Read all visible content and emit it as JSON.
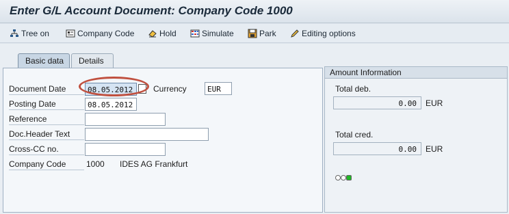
{
  "window": {
    "title": "Enter G/L Account Document: Company Code 1000"
  },
  "toolbar": {
    "tree_on": "Tree on",
    "company_code": "Company Code",
    "hold": "Hold",
    "simulate": "Simulate",
    "park": "Park",
    "editing_options": "Editing options"
  },
  "tabs": [
    {
      "label": "Basic data",
      "active": true
    },
    {
      "label": "Details",
      "active": false
    }
  ],
  "basic_data": {
    "document_date": {
      "label": "Document Date",
      "value": "08.05.2012"
    },
    "currency": {
      "label": "Currency",
      "value": "EUR"
    },
    "posting_date": {
      "label": "Posting Date",
      "value": "08.05.2012"
    },
    "reference": {
      "label": "Reference",
      "value": ""
    },
    "doc_header_text": {
      "label": "Doc.Header Text",
      "value": ""
    },
    "cross_cc_no": {
      "label": "Cross-CC no.",
      "value": ""
    },
    "company_code": {
      "label": "Company Code",
      "value": "1000",
      "name": "IDES AG Frankfurt"
    }
  },
  "amount_info": {
    "title": "Amount Information",
    "total_deb": {
      "label": "Total deb.",
      "value": "0.00",
      "currency": "EUR"
    },
    "total_cred": {
      "label": "Total cred.",
      "value": "0.00",
      "currency": "EUR"
    },
    "status_light": {
      "icon": "traffic-light-icon",
      "state": "green"
    }
  },
  "colors": {
    "highlight_oval": "#c0503f",
    "status_green": "#1fb824"
  }
}
